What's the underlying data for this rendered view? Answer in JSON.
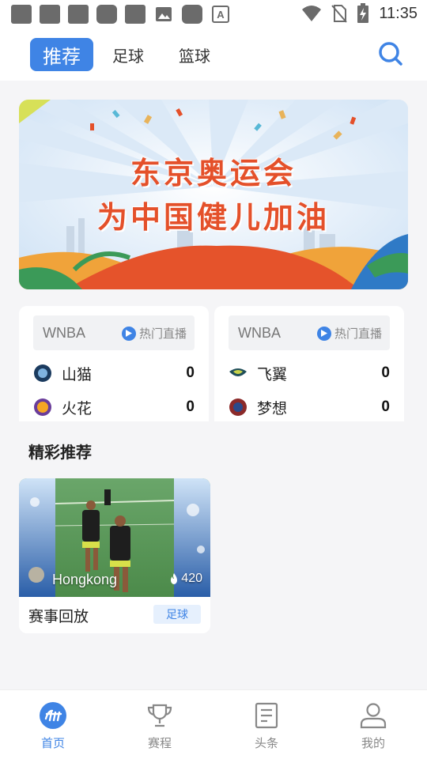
{
  "status_bar": {
    "time": "11:35",
    "icons": [
      "notification-square-icon",
      "notification-square-icon",
      "notification-square-icon",
      "notification-square-icon",
      "notification-square-icon",
      "image-icon",
      "notification-square-icon",
      "font-a-icon",
      "wifi-icon",
      "no-sim-icon",
      "battery-charging-icon"
    ]
  },
  "header": {
    "tabs": [
      {
        "label": "推荐",
        "active": true
      },
      {
        "label": "足球",
        "active": false
      },
      {
        "label": "篮球",
        "active": false
      }
    ],
    "search_icon": "search-icon"
  },
  "banner": {
    "line1": "东京奥运会",
    "line2": "为中国健儿加油"
  },
  "matches": [
    {
      "league": "WNBA",
      "live_label": "热门直播",
      "teams": [
        {
          "name": "山猫",
          "score": "0"
        },
        {
          "name": "火花",
          "score": "0"
        }
      ]
    },
    {
      "league": "WNBA",
      "live_label": "热门直播",
      "teams": [
        {
          "name": "飞翼",
          "score": "0"
        },
        {
          "name": "梦想",
          "score": "0"
        }
      ]
    }
  ],
  "section": {
    "title": "精彩推荐"
  },
  "video": {
    "channel": "Hongkong",
    "views": "420",
    "title": "赛事回放",
    "tag": "足球"
  },
  "bottom_nav": [
    {
      "label": "首页",
      "icon": "home-logo-icon",
      "active": true
    },
    {
      "label": "赛程",
      "icon": "trophy-icon",
      "active": false
    },
    {
      "label": "头条",
      "icon": "document-icon",
      "active": false
    },
    {
      "label": "我的",
      "icon": "user-icon",
      "active": false
    }
  ],
  "colors": {
    "accent": "#3f84e5",
    "banner_text": "#e4502a"
  }
}
